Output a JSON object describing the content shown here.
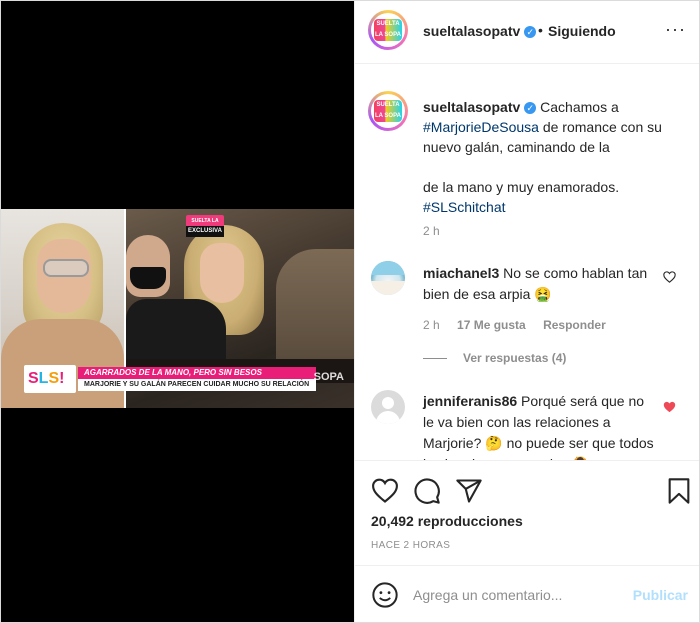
{
  "post": {
    "account": "sueltalasopatv",
    "follow_dot": "•",
    "follow_status": "Siguiendo",
    "more": "···",
    "avatar_text": "SUELTA LA SOPA"
  },
  "video": {
    "corner_badge_top": "SUELTA LA SOPA",
    "corner_badge_bottom": "EXCLUSIVA",
    "logo_letters": [
      "S",
      "L",
      "S",
      "!"
    ],
    "headline": "AGARRADOS DE LA MANO, PERO SIN BESOS",
    "subheadline": "MARJORIE Y SU GALÁN PARECEN CUIDAR MUCHO SU RELACIÓN",
    "watermark": "SOPA"
  },
  "caption": {
    "username": "sueltalasopatv",
    "line1": "Cachamos a",
    "mention": "#MarjorieDeSousa",
    "line2": "de romance con su",
    "line3": "nuevo galán, caminando de la",
    "line4": "de la mano y muy enamorados.",
    "hashtag": "#SLSchitchat",
    "time": "2 h"
  },
  "comments": [
    {
      "username": "miachanel3",
      "text": "No se como hablan tan bien de esa arpia 🤮",
      "time": "2 h",
      "likes": "17 Me gusta",
      "reply": "Responder",
      "view_replies": "Ver respuestas (4)"
    },
    {
      "username": "jenniferanis86",
      "text": "Porqué será que no le va bien con las relaciones a Marjorie? 🤔 no puede ser que todos los hombre sean malos 🙆",
      "liked_color": "#ed4956"
    }
  ],
  "actions": {
    "views": "20,492 reproducciones",
    "time_ago": "HACE 2 HORAS",
    "comment_placeholder": "Agrega un comentario...",
    "post_button": "Publicar"
  },
  "colors": {
    "link": "#00376b",
    "verified": "#3897f0",
    "muted": "#8e8e8e",
    "publish_disabled": "#b2dffc"
  }
}
